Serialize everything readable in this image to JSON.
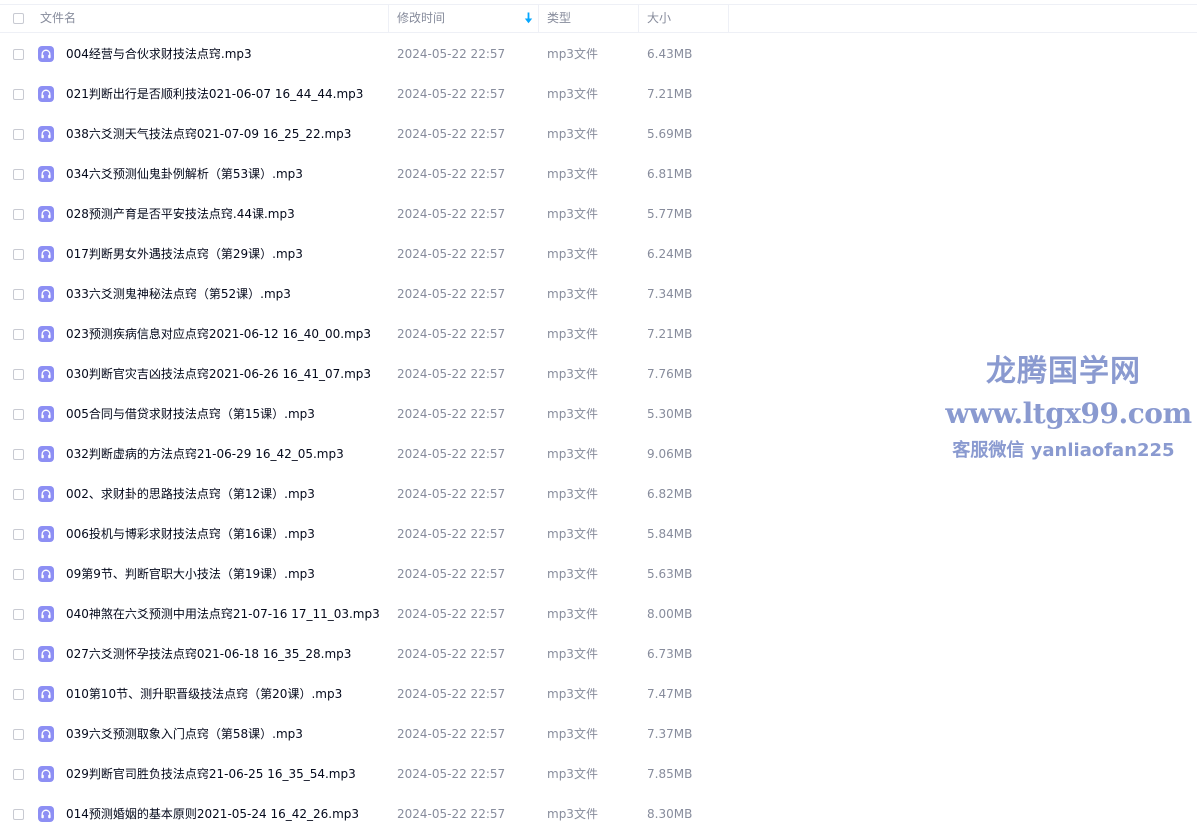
{
  "header": {
    "name_label": "文件名",
    "time_label": "修改时间",
    "type_label": "类型",
    "size_label": "大小",
    "sort_icon": "arrow-down-icon"
  },
  "files": [
    {
      "name": "004经营与合伙求财技法点窍.mp3",
      "time": "2024-05-22 22:57",
      "type": "mp3文件",
      "size": "6.43MB"
    },
    {
      "name": "021判断出行是否顺利技法021-06-07 16_44_44.mp3",
      "time": "2024-05-22 22:57",
      "type": "mp3文件",
      "size": "7.21MB"
    },
    {
      "name": "038六爻测天气技法点窍021-07-09 16_25_22.mp3",
      "time": "2024-05-22 22:57",
      "type": "mp3文件",
      "size": "5.69MB"
    },
    {
      "name": "034六爻预测仙鬼卦例解析（第53课）.mp3",
      "time": "2024-05-22 22:57",
      "type": "mp3文件",
      "size": "6.81MB"
    },
    {
      "name": "028预测产育是否平安技法点窍.44课.mp3",
      "time": "2024-05-22 22:57",
      "type": "mp3文件",
      "size": "5.77MB"
    },
    {
      "name": "017判断男女外遇技法点窍（第29课）.mp3",
      "time": "2024-05-22 22:57",
      "type": "mp3文件",
      "size": "6.24MB"
    },
    {
      "name": "033六爻测鬼神秘法点窍（第52课）.mp3",
      "time": "2024-05-22 22:57",
      "type": "mp3文件",
      "size": "7.34MB"
    },
    {
      "name": "023预测疾病信息对应点窍2021-06-12 16_40_00.mp3",
      "time": "2024-05-22 22:57",
      "type": "mp3文件",
      "size": "7.21MB"
    },
    {
      "name": "030判断官灾吉凶技法点窍2021-06-26 16_41_07.mp3",
      "time": "2024-05-22 22:57",
      "type": "mp3文件",
      "size": "7.76MB"
    },
    {
      "name": "005合同与借贷求财技法点窍（第15课）.mp3",
      "time": "2024-05-22 22:57",
      "type": "mp3文件",
      "size": "5.30MB"
    },
    {
      "name": "032判断虚病的方法点窍21-06-29 16_42_05.mp3",
      "time": "2024-05-22 22:57",
      "type": "mp3文件",
      "size": "9.06MB"
    },
    {
      "name": "002、求财卦的思路技法点窍（第12课）.mp3",
      "time": "2024-05-22 22:57",
      "type": "mp3文件",
      "size": "6.82MB"
    },
    {
      "name": "006投机与博彩求财技法点窍（第16课）.mp3",
      "time": "2024-05-22 22:57",
      "type": "mp3文件",
      "size": "5.84MB"
    },
    {
      "name": "09第9节、判断官职大小技法（第19课）.mp3",
      "time": "2024-05-22 22:57",
      "type": "mp3文件",
      "size": "5.63MB"
    },
    {
      "name": "040神煞在六爻预测中用法点窍21-07-16 17_11_03.mp3",
      "time": "2024-05-22 22:57",
      "type": "mp3文件",
      "size": "8.00MB"
    },
    {
      "name": "027六爻测怀孕技法点窍021-06-18 16_35_28.mp3",
      "time": "2024-05-22 22:57",
      "type": "mp3文件",
      "size": "6.73MB"
    },
    {
      "name": "010第10节、测升职晋级技法点窍（第20课）.mp3",
      "time": "2024-05-22 22:57",
      "type": "mp3文件",
      "size": "7.47MB"
    },
    {
      "name": "039六爻预测取象入门点窍（第58课）.mp3",
      "time": "2024-05-22 22:57",
      "type": "mp3文件",
      "size": "7.37MB"
    },
    {
      "name": "029判断官司胜负技法点窍21-06-25 16_35_54.mp3",
      "time": "2024-05-22 22:57",
      "type": "mp3文件",
      "size": "7.85MB"
    },
    {
      "name": "014预测婚姻的基本原则2021-05-24 16_42_26.mp3",
      "time": "2024-05-22 22:57",
      "type": "mp3文件",
      "size": "8.30MB"
    }
  ],
  "file_icon": "headphones-icon",
  "watermark": {
    "title": "龙腾国学网",
    "url": "www.ltgx99.com",
    "contact": "客服微信 yanliaofan225"
  },
  "colors": {
    "icon_bg": "#8d8ff4",
    "primary_text": "#03081a",
    "secondary_text": "#878c9c",
    "sort_accent": "#06a7ff",
    "watermark": "#8a9ad0"
  }
}
